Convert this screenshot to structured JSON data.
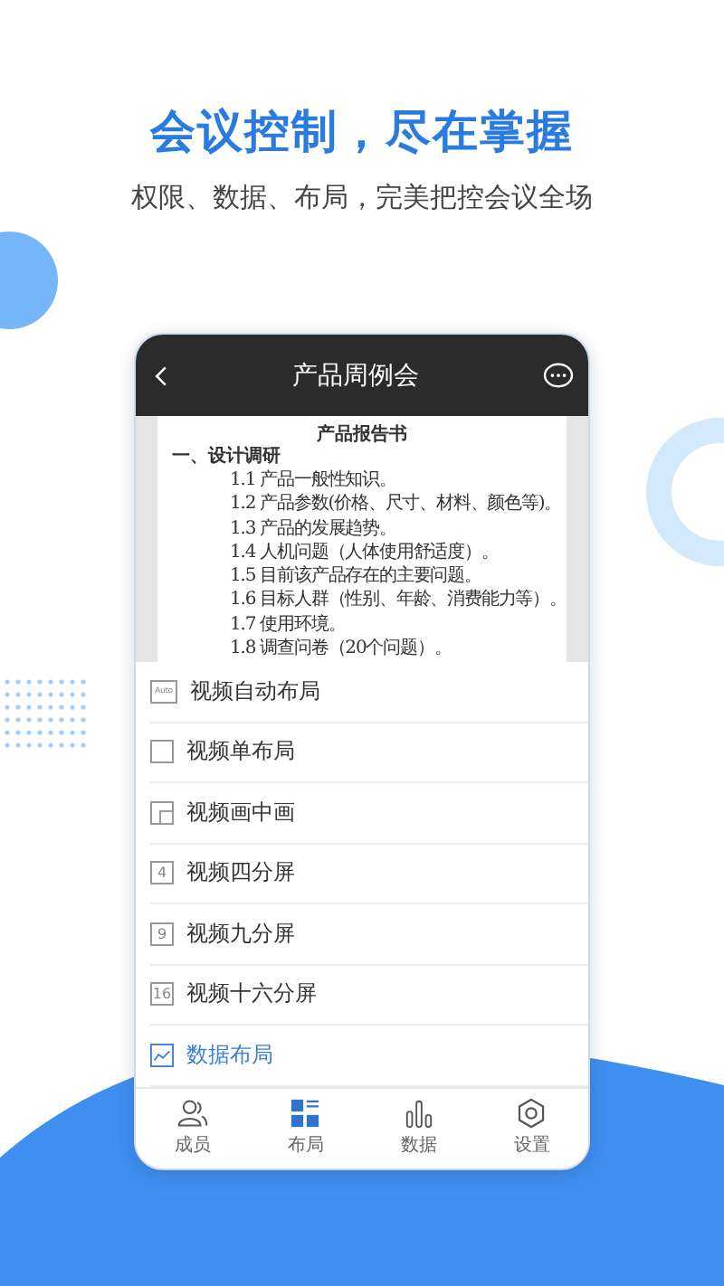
{
  "headline": "会议控制，尽在掌握",
  "subtitle": "权限、数据、布局，完美把控会议全场",
  "app": {
    "title": "产品周例会",
    "document": {
      "title": "产品报告书",
      "section": "一、设计调研",
      "lines": [
        "1.1 产品一般性知识。",
        "1.2 产品参数(价格、尺寸、材料、颜色等)。",
        "1.3 产品的发展趋势。",
        "1.4 人机问题（人体使用舒适度）。",
        "1.5 目前该产品存在的主要问题。",
        "1.6 目标人群（性别、年龄、消费能力等）。",
        "1.7 使用环境。",
        "1.8 调查问卷（20个问题）。"
      ]
    },
    "layouts": [
      {
        "kind": "auto",
        "icon_text": "Auto",
        "label": "视频自动布局",
        "selected": false
      },
      {
        "kind": "single",
        "label": "视频单布局",
        "selected": false
      },
      {
        "kind": "pip",
        "label": "视频画中画",
        "selected": false
      },
      {
        "kind": "number",
        "icon_text": "4",
        "label": "视频四分屏",
        "selected": false
      },
      {
        "kind": "number",
        "icon_text": "9",
        "label": "视频九分屏",
        "selected": false
      },
      {
        "kind": "number",
        "icon_text": "16",
        "label": "视频十六分屏",
        "selected": false
      },
      {
        "kind": "chart",
        "label": "数据布局",
        "selected": true
      }
    ],
    "tabs": [
      {
        "kind": "members",
        "label": "成员",
        "selected": false
      },
      {
        "kind": "layout",
        "label": "布局",
        "selected": true
      },
      {
        "kind": "data",
        "label": "数据",
        "selected": false
      },
      {
        "kind": "settings",
        "label": "设置",
        "selected": false
      }
    ]
  }
}
